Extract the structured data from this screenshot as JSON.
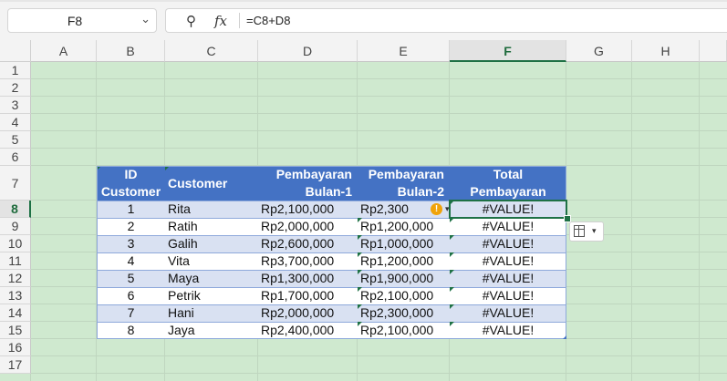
{
  "name_box": {
    "value": "F8"
  },
  "formula_bar": {
    "formula": "=C8+D8",
    "fx_label": "fx"
  },
  "columns": [
    "A",
    "B",
    "C",
    "D",
    "E",
    "F",
    "G",
    "H"
  ],
  "rows": [
    "1",
    "2",
    "3",
    "4",
    "5",
    "6",
    "7",
    "8",
    "9",
    "10",
    "11",
    "12",
    "13",
    "14",
    "15",
    "16",
    "17"
  ],
  "table": {
    "headers": {
      "id_line1": "ID",
      "id_line2": "Customer",
      "customer": "Customer",
      "bulan1_line1": "Pembayaran",
      "bulan1_line2": "Bulan-1",
      "bulan2_line1": "Pembayaran",
      "bulan2_line2": "Bulan-2",
      "total_line1": "Total",
      "total_line2": "Pembayaran"
    },
    "rows": [
      {
        "id": "1",
        "customer": "Rita",
        "bulan1": "Rp2,100,000",
        "bulan2": "Rp2,300",
        "total": "#VALUE!"
      },
      {
        "id": "2",
        "customer": "Ratih",
        "bulan1": "Rp2,000,000",
        "bulan2": "Rp1,200,000",
        "total": "#VALUE!"
      },
      {
        "id": "3",
        "customer": "Galih",
        "bulan1": "Rp2,600,000",
        "bulan2": "Rp1,000,000",
        "total": "#VALUE!"
      },
      {
        "id": "4",
        "customer": "Vita",
        "bulan1": "Rp3,700,000",
        "bulan2": "Rp1,200,000",
        "total": "#VALUE!"
      },
      {
        "id": "5",
        "customer": "Maya",
        "bulan1": "Rp1,300,000",
        "bulan2": "Rp1,900,000",
        "total": "#VALUE!"
      },
      {
        "id": "6",
        "customer": "Petrik",
        "bulan1": "Rp1,700,000",
        "bulan2": "Rp2,100,000",
        "total": "#VALUE!"
      },
      {
        "id": "7",
        "customer": "Hani",
        "bulan1": "Rp2,000,000",
        "bulan2": "Rp2,300,000",
        "total": "#VALUE!"
      },
      {
        "id": "8",
        "customer": "Jaya",
        "bulan1": "Rp2,400,000",
        "bulan2": "Rp2,100,000",
        "total": "#VALUE!"
      }
    ]
  },
  "icons": {
    "zoom": "zoom-formula-icon",
    "warning": "error-warning-icon",
    "quick_analysis": "quick-analysis-icon"
  },
  "colors": {
    "header_blue": "#4472c4",
    "band_light": "#d9e1f2",
    "sheet_green": "#cfe9cf",
    "selection": "#1e7145"
  }
}
